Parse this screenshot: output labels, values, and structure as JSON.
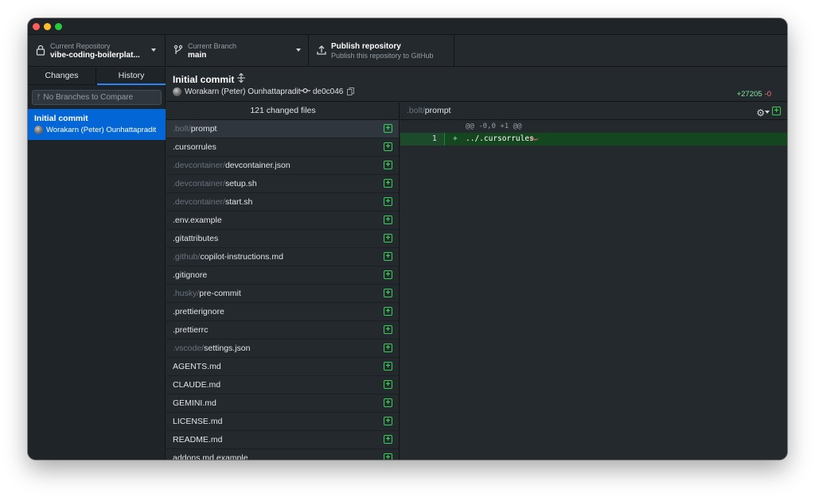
{
  "toolbar": {
    "repo_label": "Current Repository",
    "repo_value": "vibe-coding-boilerplat...",
    "branch_label": "Current Branch",
    "branch_value": "main",
    "publish_title": "Publish repository",
    "publish_desc": "Publish this repository to GitHub"
  },
  "sidebar": {
    "tabs": [
      "Changes",
      "History"
    ],
    "active_tab": "History",
    "compare_placeholder": "No Branches to Compare",
    "commits": [
      {
        "title": "Initial commit",
        "author": "Worakarn (Peter) Ounhattapradit"
      }
    ]
  },
  "commit": {
    "title": "Initial commit",
    "author": "Worakarn (Peter) Ounhattapradit",
    "sha": "de0c046",
    "additions": "+27205",
    "deletions": "-0"
  },
  "files": {
    "header": "121 changed files",
    "items": [
      {
        "dir": ".bolt/",
        "name": "prompt"
      },
      {
        "dir": "",
        "name": ".cursorrules"
      },
      {
        "dir": ".devcontainer/",
        "name": "devcontainer.json"
      },
      {
        "dir": ".devcontainer/",
        "name": "setup.sh"
      },
      {
        "dir": ".devcontainer/",
        "name": "start.sh"
      },
      {
        "dir": "",
        "name": ".env.example"
      },
      {
        "dir": "",
        "name": ".gitattributes"
      },
      {
        "dir": ".github/",
        "name": "copilot-instructions.md"
      },
      {
        "dir": "",
        "name": ".gitignore"
      },
      {
        "dir": ".husky/",
        "name": "pre-commit"
      },
      {
        "dir": "",
        "name": ".prettierignore"
      },
      {
        "dir": "",
        "name": ".prettierrc"
      },
      {
        "dir": ".vscode/",
        "name": "settings.json"
      },
      {
        "dir": "",
        "name": "AGENTS.md"
      },
      {
        "dir": "",
        "name": "CLAUDE.md"
      },
      {
        "dir": "",
        "name": "GEMINI.md"
      },
      {
        "dir": "",
        "name": "LICENSE.md"
      },
      {
        "dir": "",
        "name": "README.md"
      },
      {
        "dir": "",
        "name": "addons.md.example"
      }
    ]
  },
  "diff": {
    "path_dir": ".bolt/",
    "path_name": "prompt",
    "hunk": "@@ -0,0 +1 @@",
    "line_number": "1",
    "line_prefix": "+",
    "line_code": "../.cursorrules"
  },
  "colors": {
    "selected_commit": "#0366d6",
    "added": "#34d058",
    "deleted": "#f97583",
    "tab_accent": "#2f81f7"
  }
}
